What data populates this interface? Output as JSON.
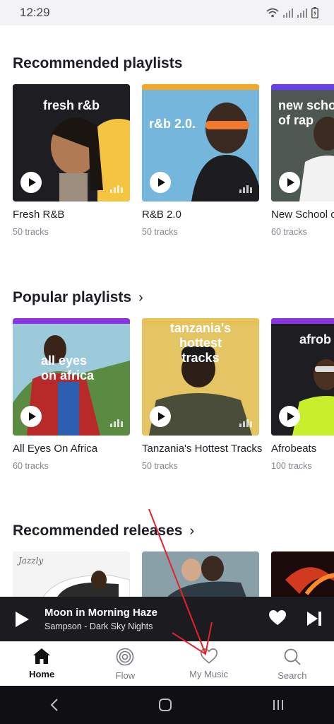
{
  "status_bar": {
    "time": "12:29"
  },
  "sections": {
    "recommended_playlists": {
      "title": "Recommended playlists",
      "cards": [
        {
          "cover_text": "fresh r&b",
          "title": "Fresh R&B",
          "tracks": "50 tracks",
          "strip_color": "#1e1e22"
        },
        {
          "cover_text": "r&b 2.0.",
          "title": "R&B 2.0",
          "tracks": "50 tracks",
          "strip_color": "#f5a623"
        },
        {
          "cover_text": "new scho of rap",
          "title": "New School o",
          "tracks": "60 tracks",
          "strip_color": "#6a3df0"
        }
      ]
    },
    "popular_playlists": {
      "title": "Popular playlists",
      "cards": [
        {
          "cover_text": "all eyes on africa",
          "title": "All Eyes On Africa",
          "tracks": "60 tracks",
          "strip_color": "#8a35e0"
        },
        {
          "cover_text": "tanzania's hottest tracks",
          "title": "Tanzania's Hottest Tracks",
          "tracks": "50 tracks",
          "strip_color": "#e8c254"
        },
        {
          "cover_text": "afrob",
          "title": "Afrobeats",
          "tracks": "100 tracks",
          "strip_color": "#8a35e0"
        }
      ]
    },
    "recommended_releases": {
      "title": "Recommended releases",
      "cover_signature": "Jazzly"
    }
  },
  "mini_player": {
    "title": "Moon in Morning Haze",
    "subtitle": "Sampson - Dark Sky Nights"
  },
  "bottom_nav": [
    {
      "label": "Home",
      "icon": "home-icon",
      "active": true
    },
    {
      "label": "Flow",
      "icon": "flow-icon",
      "active": false
    },
    {
      "label": "My Music",
      "icon": "heart-icon",
      "active": false
    },
    {
      "label": "Search",
      "icon": "search-icon",
      "active": false
    }
  ],
  "colors": {
    "accent": "#a238ff",
    "annotation_arrow": "#e8202a"
  }
}
